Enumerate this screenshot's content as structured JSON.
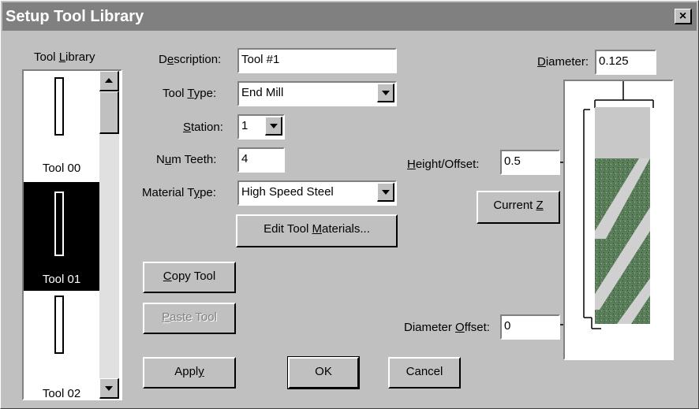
{
  "window": {
    "title": "Setup Tool Library",
    "close_glyph": "×"
  },
  "tool_library": {
    "label_pre": "Tool ",
    "label_mn": "L",
    "label_post": "ibrary",
    "items": [
      {
        "label": "Tool 00"
      },
      {
        "label": "Tool 01"
      },
      {
        "label": "Tool 02"
      }
    ],
    "selected_index": 1
  },
  "fields": {
    "description": {
      "label_pre": "D",
      "label_mn": "e",
      "label_post": "scription:",
      "value": "Tool #1"
    },
    "tool_type": {
      "label_pre": "Tool ",
      "label_mn": "T",
      "label_post": "ype:",
      "value": "End Mill"
    },
    "station": {
      "label_pre": "",
      "label_mn": "S",
      "label_post": "tation:",
      "value": "1"
    },
    "num_teeth": {
      "label_pre": "N",
      "label_mn": "u",
      "label_post": "m Teeth:",
      "value": "4"
    },
    "material_type": {
      "label_pre": "Material T",
      "label_mn": "y",
      "label_post": "pe:",
      "value": "High Speed Steel"
    },
    "diameter": {
      "label_pre": "",
      "label_mn": "D",
      "label_post": "iameter:",
      "value": "0.125"
    },
    "height_offset": {
      "label_pre": "",
      "label_mn": "H",
      "label_post": "eight/Offset:",
      "value": "0.5"
    },
    "diameter_offset": {
      "label_pre": "Diameter ",
      "label_mn": "O",
      "label_post": "ffset:",
      "value": "0"
    }
  },
  "buttons": {
    "edit_materials": {
      "pre": "Edit Tool ",
      "mn": "M",
      "post": "aterials..."
    },
    "copy_tool": {
      "pre": "",
      "mn": "C",
      "post": "opy Tool"
    },
    "paste_tool": {
      "pre": "",
      "mn": "P",
      "post": "aste Tool",
      "disabled": true
    },
    "current_z": {
      "pre": "Current ",
      "mn": "Z",
      "post": ""
    },
    "apply": {
      "pre": "Appl",
      "mn": "y",
      "post": ""
    },
    "ok": {
      "pre": "OK",
      "mn": "",
      "post": ""
    },
    "cancel": {
      "pre": "Cancel",
      "mn": "",
      "post": ""
    }
  },
  "colors": {
    "dialog_bg": "#c0c0c0",
    "title_bar": "#808080",
    "flute_green": "#5a7d5a",
    "flute_light": "#d0d0d0"
  },
  "icons": {
    "scroll_up": "up-arrow-icon",
    "scroll_down": "down-arrow-icon",
    "dropdown": "chevron-down-icon",
    "close": "close-icon"
  }
}
